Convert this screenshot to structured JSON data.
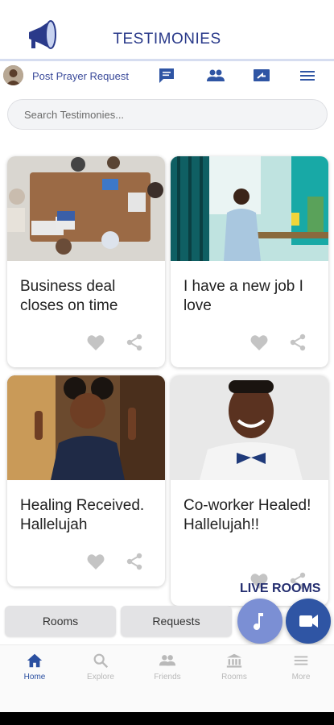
{
  "header": {
    "title": "TESTIMONIES",
    "logo_icon": "megaphone-icon"
  },
  "toolbar": {
    "post_prayer_label": "Post Prayer Request",
    "icons": [
      "chat-icon",
      "people-icon",
      "open-window-icon",
      "menu-icon"
    ]
  },
  "search": {
    "placeholder": "Search Testimonies..."
  },
  "cards": [
    {
      "text": "Business deal closes on time",
      "image": "office-meeting-photo"
    },
    {
      "text": "I have a new job I love",
      "image": "businessman-desk-photo"
    },
    {
      "text": "Healing Received. Hallelujah",
      "image": "smiling-woman-photo"
    },
    {
      "text": "Co-worker Healed! Hallelujah!!",
      "image": "smiling-man-bowtie-photo"
    }
  ],
  "live_rooms_label": "LIVE ROOMS",
  "buttons": {
    "rooms": "Rooms",
    "requests": "Requests"
  },
  "fabs": [
    {
      "icon": "music-note-icon",
      "color": "#7b8fd4"
    },
    {
      "icon": "video-camera-icon",
      "color": "#2f55a4"
    }
  ],
  "bottom_nav": [
    {
      "label": "Home",
      "icon": "home-icon",
      "active": true
    },
    {
      "label": "Explore",
      "icon": "search-icon",
      "active": false
    },
    {
      "label": "Friends",
      "icon": "friends-icon",
      "active": false
    },
    {
      "label": "Rooms",
      "icon": "building-icon",
      "active": false
    },
    {
      "label": "More",
      "icon": "menu-icon",
      "active": false
    }
  ],
  "colors": {
    "accent": "#2a3a8a",
    "nav_active": "#2a4fa0",
    "nav_inactive": "#b9b9b9",
    "fab_light": "#7b8fd4",
    "fab_dark": "#2f55a4"
  }
}
